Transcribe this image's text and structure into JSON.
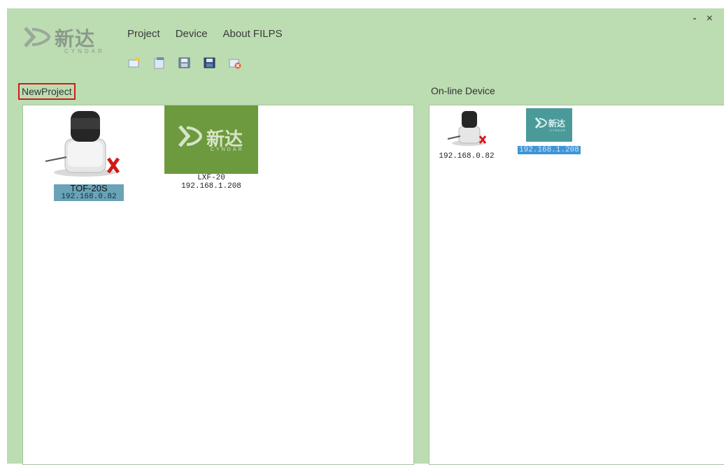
{
  "window": {
    "minimize": "-",
    "close": "×"
  },
  "logo": {
    "cn": "新达",
    "en": "CYNDAR"
  },
  "menu": [
    "Project",
    "Device",
    "About FILPS"
  ],
  "toolbar": [
    "new-project-icon",
    "open-icon",
    "save-icon",
    "save-as-icon",
    "close-project-icon"
  ],
  "left_panel": {
    "title": "NewProject",
    "devices": [
      {
        "name": "TOF-20S",
        "ip": "192.168.0.82",
        "status": "offline"
      },
      {
        "name": "LXF-20",
        "ip": "192.168.1.208",
        "logo_cn": "新达",
        "logo_en": "CYNDAR"
      }
    ]
  },
  "right_panel": {
    "title": "On-line Device",
    "devices": [
      {
        "ip": "192.168.0.82",
        "status": "offline"
      },
      {
        "ip": "192.168.1.208",
        "logo_cn": "新达",
        "logo_en": "CYNDAR"
      }
    ]
  },
  "colors": {
    "background": "#bcdcb2",
    "highlight_border": "#d01b1b",
    "tile_green": "#6d9a3e",
    "tile_teal": "#4b9a9a"
  }
}
